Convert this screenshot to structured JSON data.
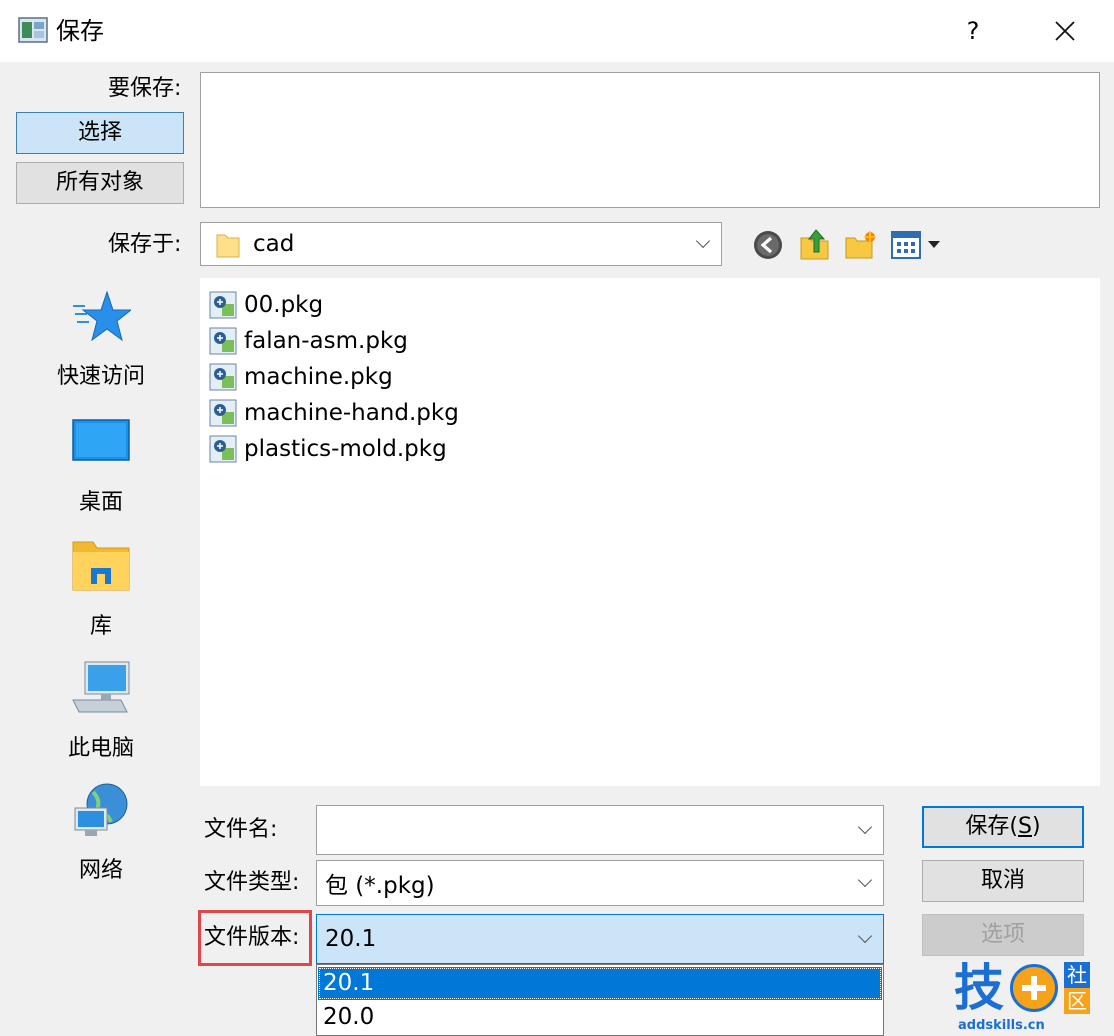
{
  "window": {
    "title": "保存",
    "help": "?",
    "close": "✕"
  },
  "top": {
    "to_save_label": "要保存:",
    "select_button": "选择",
    "all_objects_button": "所有对象"
  },
  "save_in": {
    "label": "保存于:",
    "folder": "cad"
  },
  "places": [
    {
      "label": "快速访问",
      "icon": "quick-access-star-icon"
    },
    {
      "label": "桌面",
      "icon": "desktop-icon"
    },
    {
      "label": "库",
      "icon": "libraries-folder-icon"
    },
    {
      "label": "此电脑",
      "icon": "this-pc-icon"
    },
    {
      "label": "网络",
      "icon": "network-icon"
    }
  ],
  "files": [
    {
      "name": "00.pkg"
    },
    {
      "name": "falan-asm.pkg"
    },
    {
      "name": "machine.pkg"
    },
    {
      "name": "machine-hand.pkg"
    },
    {
      "name": "plastics-mold.pkg"
    }
  ],
  "form": {
    "filename_label": "文件名:",
    "filename_value": "",
    "filetype_label": "文件类型:",
    "filetype_value": "包 (*.pkg)",
    "version_label": "文件版本:",
    "version_value": "20.1"
  },
  "buttons": {
    "save_text": "保存(",
    "save_key": "S",
    "save_close": ")",
    "cancel": "取消",
    "options": "选项"
  },
  "version_options": [
    "20.1",
    "20.0"
  ],
  "watermark": {
    "char1": "技",
    "char2": "社",
    "char3": "区",
    "site": "addskills.cn"
  },
  "colors": {
    "accent": "#0078d7",
    "highlight_box": "#e0474c"
  }
}
